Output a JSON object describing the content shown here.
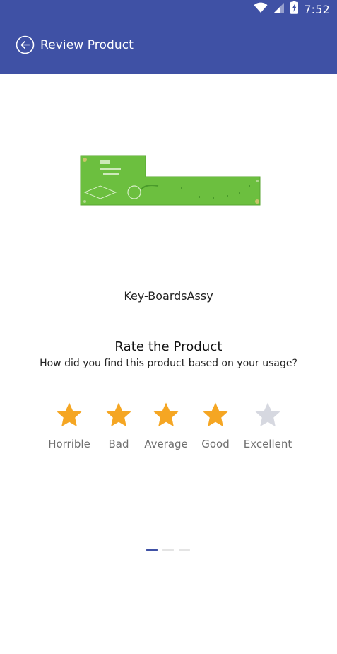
{
  "status_bar": {
    "time": "7:52",
    "icons": [
      "wifi-icon",
      "signal-icon",
      "battery-charging-icon"
    ]
  },
  "toolbar": {
    "back_icon": "back-arrow-circle-icon",
    "title": "Review Product"
  },
  "product": {
    "image_icon": "circuit-board-image",
    "name": "Key-BoardsAssy"
  },
  "rating": {
    "title": "Rate the Product",
    "subtitle": "How did you find this product based on your usage?",
    "selected_value": 4,
    "options": [
      {
        "label": "Horrible"
      },
      {
        "label": "Bad"
      },
      {
        "label": "Average"
      },
      {
        "label": "Good"
      },
      {
        "label": "Excellent"
      }
    ]
  },
  "pager": {
    "count": 3,
    "active_index": 0
  },
  "colors": {
    "primary": "#3f51a5",
    "star_filled": "#f5a623",
    "star_empty": "#d6d8e0",
    "board_green": "#6cbf3f"
  }
}
